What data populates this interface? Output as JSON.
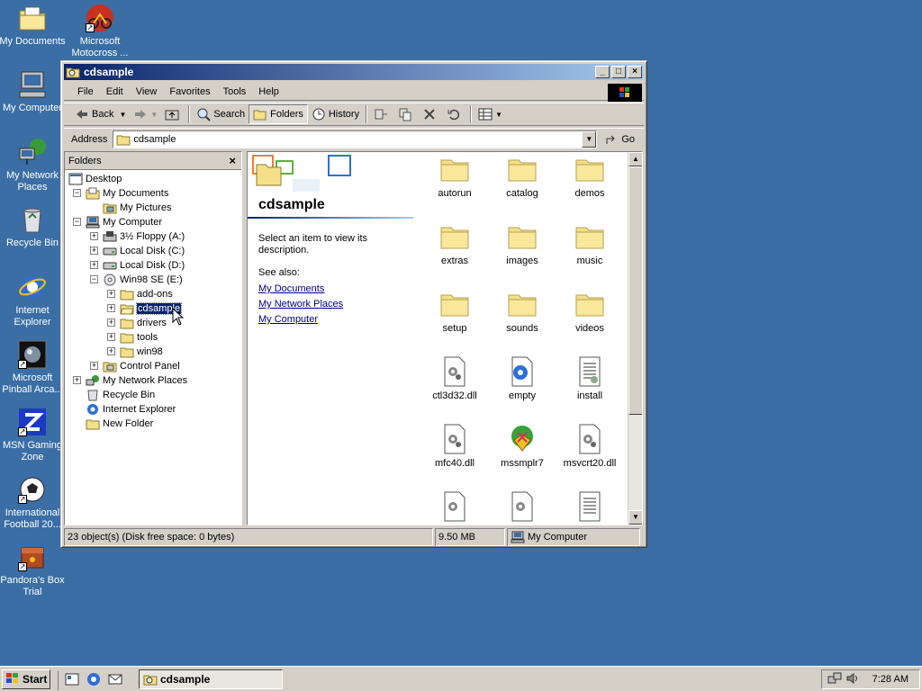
{
  "desktop": {
    "icons": [
      {
        "label": "My Documents"
      },
      {
        "label": "Microsoft Motocross ..."
      },
      {
        "label": "My Computer"
      },
      {
        "label": "My Network Places"
      },
      {
        "label": "Recycle Bin"
      },
      {
        "label": "Internet Explorer"
      },
      {
        "label": "Microsoft Pinball Arca..."
      },
      {
        "label": "MSN Gaming Zone"
      },
      {
        "label": "International Football 20..."
      },
      {
        "label": "Pandora's Box Trial"
      }
    ]
  },
  "window": {
    "title": "cdsample",
    "menu": [
      "File",
      "Edit",
      "View",
      "Favorites",
      "Tools",
      "Help"
    ],
    "toolbar": {
      "back": "Back",
      "search": "Search",
      "folders": "Folders",
      "history": "History"
    },
    "address": {
      "label": "Address",
      "value": "cdsample",
      "go": "Go"
    },
    "folders_pane": {
      "title": "Folders",
      "tree": [
        {
          "label": "Desktop"
        },
        {
          "label": "My Documents"
        },
        {
          "label": "My Pictures"
        },
        {
          "label": "My Computer"
        },
        {
          "label": "3½ Floppy (A:)"
        },
        {
          "label": "Local Disk (C:)"
        },
        {
          "label": "Local Disk (D:)"
        },
        {
          "label": "Win98 SE (E:)"
        },
        {
          "label": "add-ons"
        },
        {
          "label": "cdsample"
        },
        {
          "label": "drivers"
        },
        {
          "label": "tools"
        },
        {
          "label": "win98"
        },
        {
          "label": "Control Panel"
        },
        {
          "label": "My Network Places"
        },
        {
          "label": "Recycle Bin"
        },
        {
          "label": "Internet Explorer"
        },
        {
          "label": "New Folder"
        }
      ]
    },
    "webview": {
      "title": "cdsample",
      "description": "Select an item to view its description.",
      "see_also": "See also:",
      "links": [
        "My Documents",
        "My Network Places",
        "My Computer"
      ]
    },
    "items": [
      {
        "label": "autorun",
        "icon": "folder-icon"
      },
      {
        "label": "catalog",
        "icon": "folder-icon"
      },
      {
        "label": "demos",
        "icon": "folder-icon"
      },
      {
        "label": "extras",
        "icon": "folder-icon"
      },
      {
        "label": "images",
        "icon": "folder-icon"
      },
      {
        "label": "music",
        "icon": "folder-icon"
      },
      {
        "label": "setup",
        "icon": "folder-icon"
      },
      {
        "label": "sounds",
        "icon": "folder-icon"
      },
      {
        "label": "videos",
        "icon": "folder-icon"
      },
      {
        "label": "ctl3d32.dll",
        "icon": "dll-file-icon"
      },
      {
        "label": "empty",
        "icon": "html-file-icon"
      },
      {
        "label": "install",
        "icon": "text-file-icon"
      },
      {
        "label": "mfc40.dll",
        "icon": "dll-file-icon"
      },
      {
        "label": "mssmplr7",
        "icon": "app-icon"
      },
      {
        "label": "msvcrt20.dll",
        "icon": "dll-file-icon"
      },
      {
        "label": "",
        "icon": "dll-file-icon"
      },
      {
        "label": "",
        "icon": "dll-file-icon"
      },
      {
        "label": "",
        "icon": "text-file-icon"
      }
    ],
    "status": {
      "objects": "23 object(s) (Disk free space: 0 bytes)",
      "size": "9.50 MB",
      "zone": "My Computer"
    }
  },
  "taskbar": {
    "start": "Start",
    "task": "cdsample",
    "clock": "7:28 AM"
  },
  "colors": {
    "desktop": "#3a6ea5",
    "titlebar_active": "#0a246a",
    "face": "#d4d0c8",
    "folder": "#f5e08a"
  }
}
